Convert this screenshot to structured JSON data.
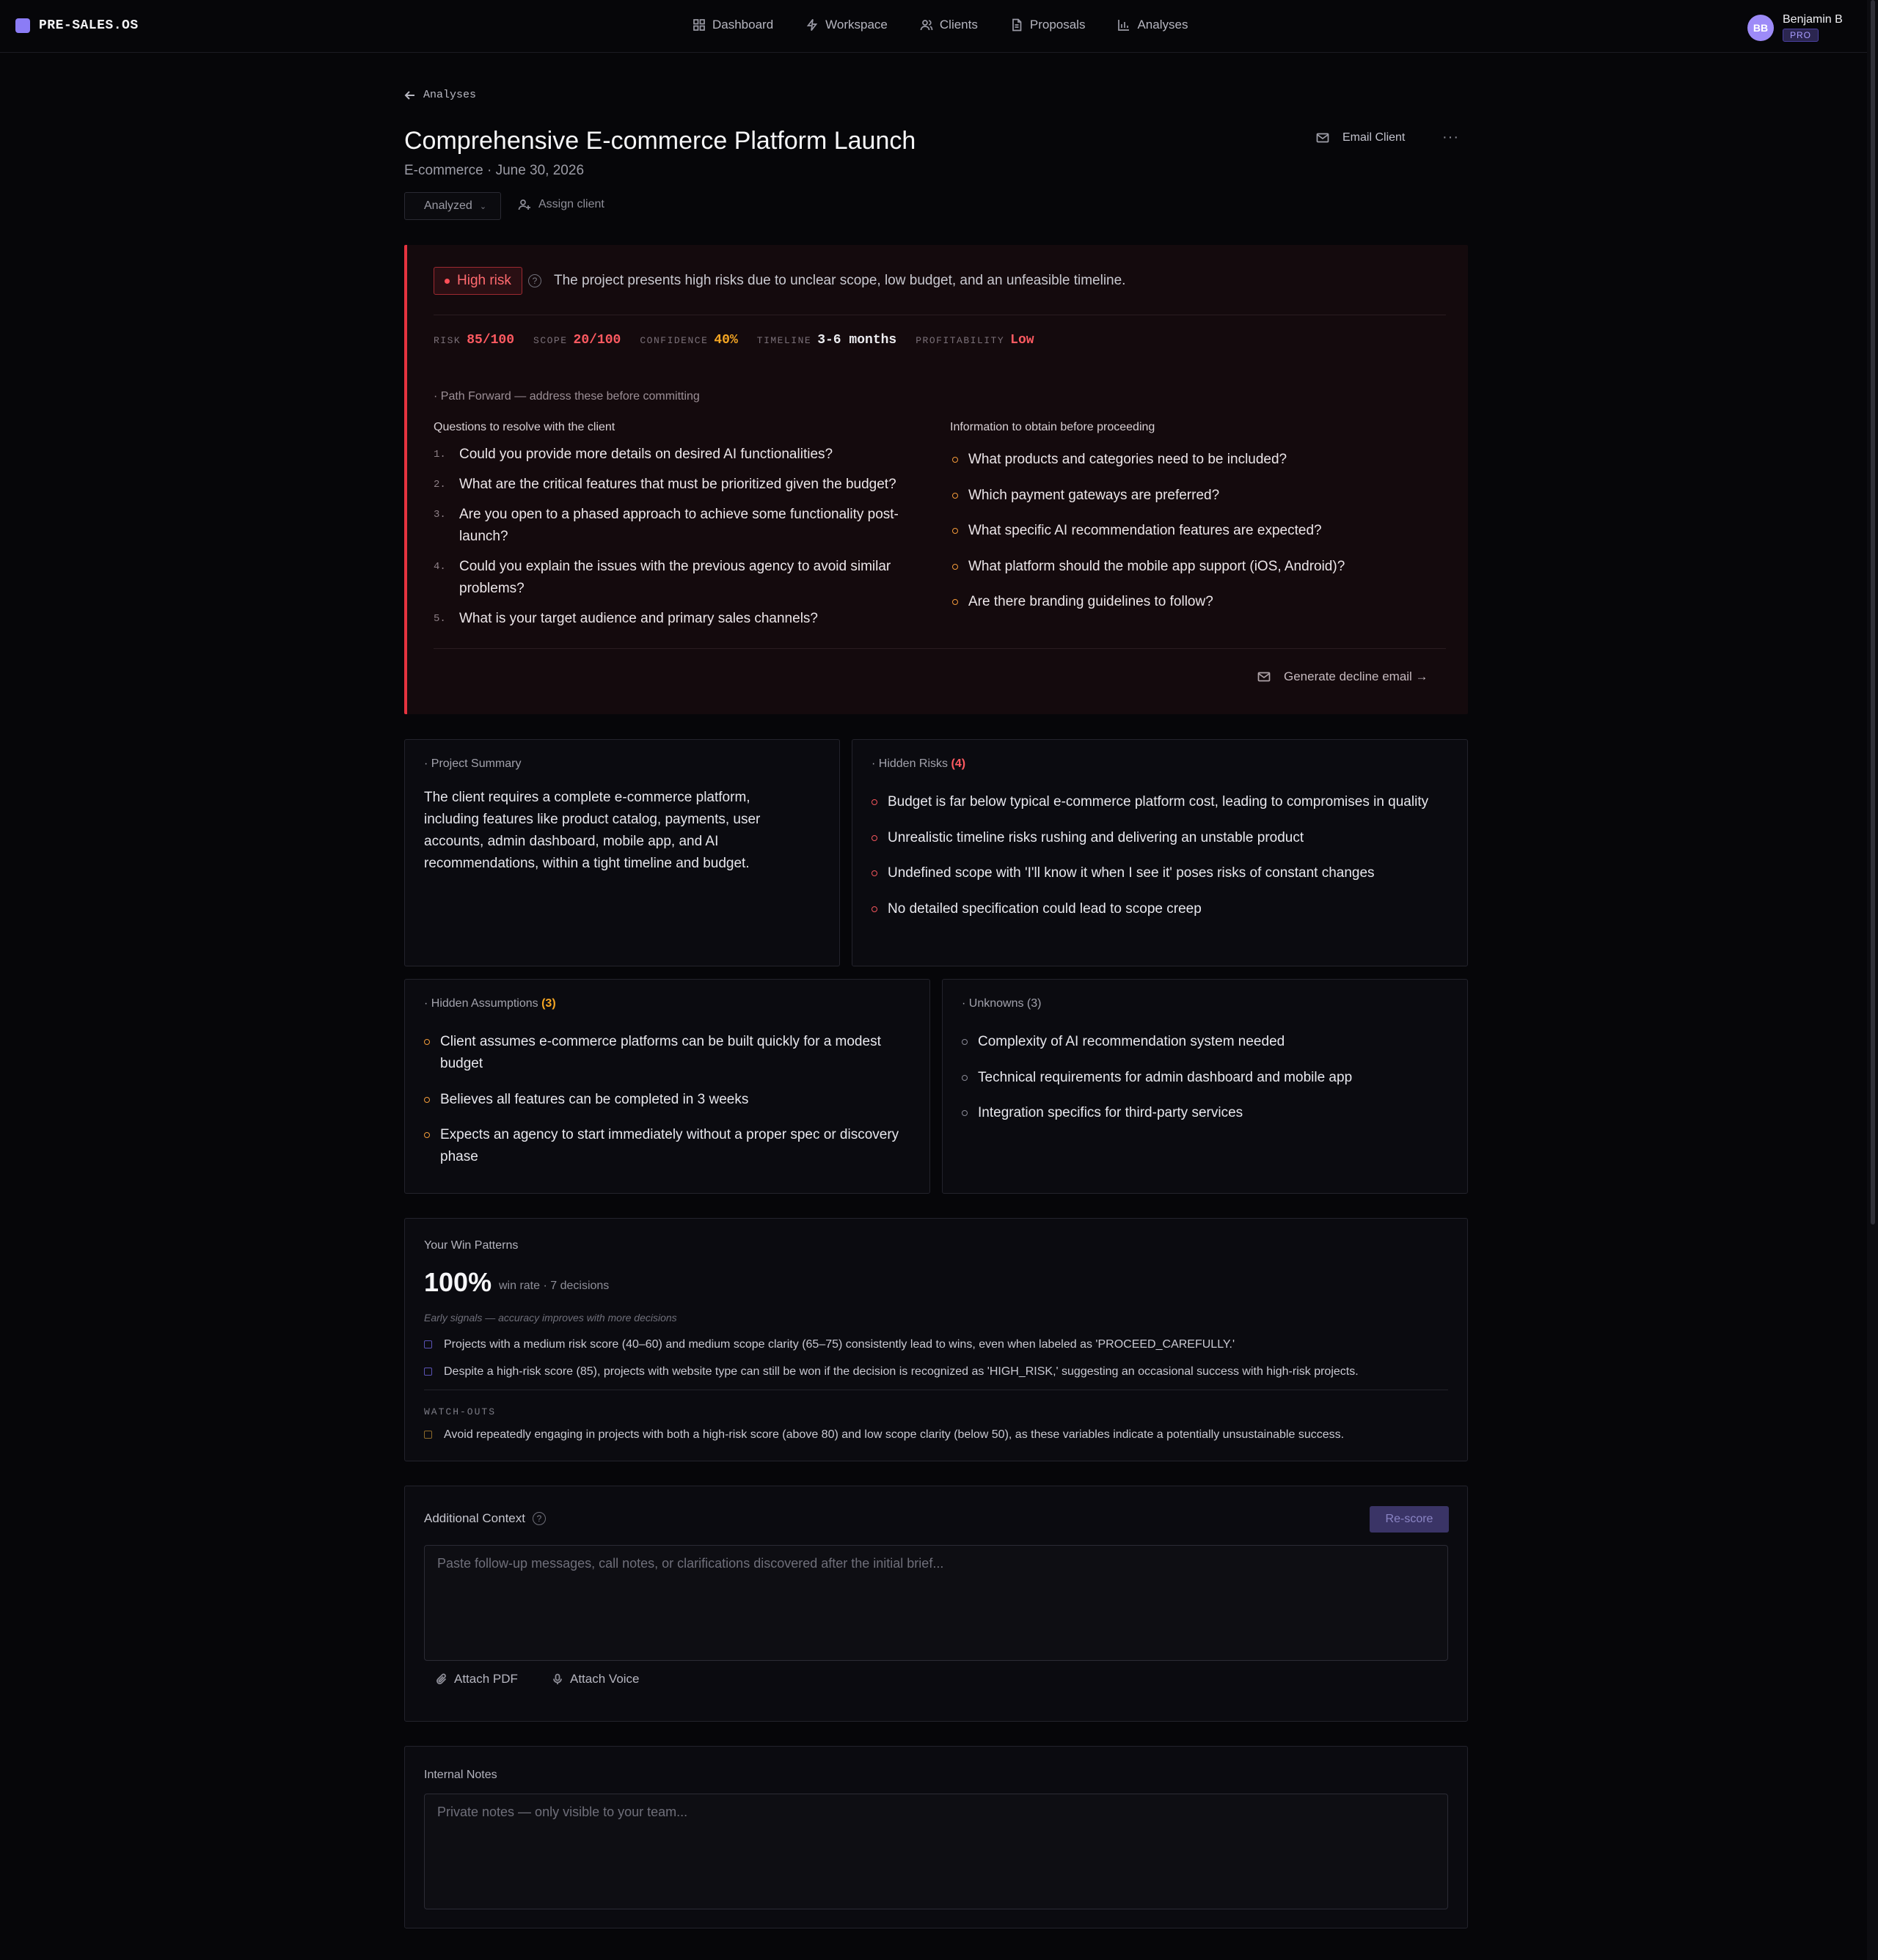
{
  "app": {
    "logo_text": "PRE-SALES.OS",
    "nav": [
      {
        "label": "Dashboard",
        "icon": "grid-icon"
      },
      {
        "label": "Workspace",
        "icon": "bolt-icon"
      },
      {
        "label": "Clients",
        "icon": "users-icon"
      },
      {
        "label": "Proposals",
        "icon": "document-icon"
      },
      {
        "label": "Analyses",
        "icon": "bar-chart-icon"
      }
    ],
    "user": {
      "initials": "BB",
      "name": "Benjamin B",
      "badge": "PRO"
    }
  },
  "header": {
    "back_label": "Analyses",
    "title": "Comprehensive E-commerce Platform Launch",
    "subtitle": "E-commerce · June 30, 2026",
    "status": "Analyzed",
    "assign_label": "Assign client",
    "email_label": "Email Client",
    "more_label": "···"
  },
  "risk": {
    "badge": "High risk",
    "summary": "The project presents high risks due to unclear scope, low budget, and an unfeasible timeline.",
    "metrics": [
      {
        "label": "RISK",
        "value": "85/100",
        "color": "#ff5a61"
      },
      {
        "label": "SCOPE",
        "value": "20/100",
        "color": "#ff5a61"
      },
      {
        "label": "CONFIDENCE",
        "value": "40%",
        "color": "#f5a623"
      },
      {
        "label": "TIMELINE",
        "value": "3-6 months",
        "color": "#ececf0"
      },
      {
        "label": "PROFITABILITY",
        "value": "Low",
        "color": "#ff5a61"
      }
    ],
    "path_title": "· Path Forward — address these before committing",
    "questions_title": "Questions to resolve with the client",
    "questions": [
      {
        "num": "1.",
        "text": "Could you provide more details on desired AI functionalities?"
      },
      {
        "num": "2.",
        "text": "What are the critical features that must be prioritized given the budget?"
      },
      {
        "num": "3.",
        "text": "Are you open to a phased approach to achieve some functionality post-launch?"
      },
      {
        "num": "4.",
        "text": "Could you explain the issues with the previous agency to avoid similar problems?"
      },
      {
        "num": "5.",
        "text": "What is your target audience and primary sales channels?"
      }
    ],
    "info_title": "Information to obtain before proceeding",
    "info": [
      "What products and categories need to be included?",
      "Which payment gateways are preferred?",
      "What specific AI recommendation features are expected?",
      "What platform should the mobile app support (iOS, Android)?",
      "Are there branding guidelines to follow?"
    ],
    "decline_label": "Generate decline email →"
  },
  "summary": {
    "title": "· Project Summary",
    "text": "The client requires a complete e-commerce platform, including features like product catalog, payments, user accounts, admin dashboard, mobile app, and AI recommendations, within a tight timeline and budget."
  },
  "hidden_risks": {
    "title": "· Hidden Risks",
    "count": "(4)",
    "items": [
      "Budget is far below typical e-commerce platform cost, leading to compromises in quality",
      "Unrealistic timeline risks rushing and delivering an unstable product",
      "Undefined scope with 'I'll know it when I see it' poses risks of constant changes",
      "No detailed specification could lead to scope creep"
    ]
  },
  "hidden_assumptions": {
    "title": "· Hidden Assumptions",
    "count": "(3)",
    "items": [
      "Client assumes e-commerce platforms can be built quickly for a modest budget",
      "Believes all features can be completed in 3 weeks",
      "Expects an agency to start immediately without a proper spec or discovery phase"
    ]
  },
  "unknowns": {
    "title": "· Unknowns (3)",
    "items": [
      "Complexity of AI recommendation system needed",
      "Technical requirements for admin dashboard and mobile app",
      "Integration specifics for third-party services"
    ]
  },
  "win_patterns": {
    "title": "Your Win Patterns",
    "rate": "100%",
    "rate_label": "win rate · 7 decisions",
    "early_note": "Early signals — accuracy improves with more decisions",
    "patterns": [
      "Projects with a medium risk score (40–60) and medium scope clarity (65–75) consistently lead to wins, even when labeled as 'PROCEED_CAREFULLY.'",
      "Despite a high-risk score (85), projects with website type can still be won if the decision is recognized as 'HIGH_RISK,' suggesting an occasional success with high-risk projects."
    ],
    "watch_title": "WATCH-OUTS",
    "watch": "Avoid repeatedly engaging in projects with both a high-risk score (above 80) and low scope clarity (below 50), as these variables indicate a potentially unsustainable success."
  },
  "additional_context": {
    "title": "Additional Context",
    "rescore_label": "Re-score",
    "placeholder": "Paste follow-up messages, call notes, or clarifications discovered after the initial brief...",
    "attach_pdf": "Attach PDF",
    "attach_voice": "Attach Voice"
  },
  "internal_notes": {
    "title": "Internal Notes",
    "placeholder": "Private notes — only visible to your team..."
  }
}
